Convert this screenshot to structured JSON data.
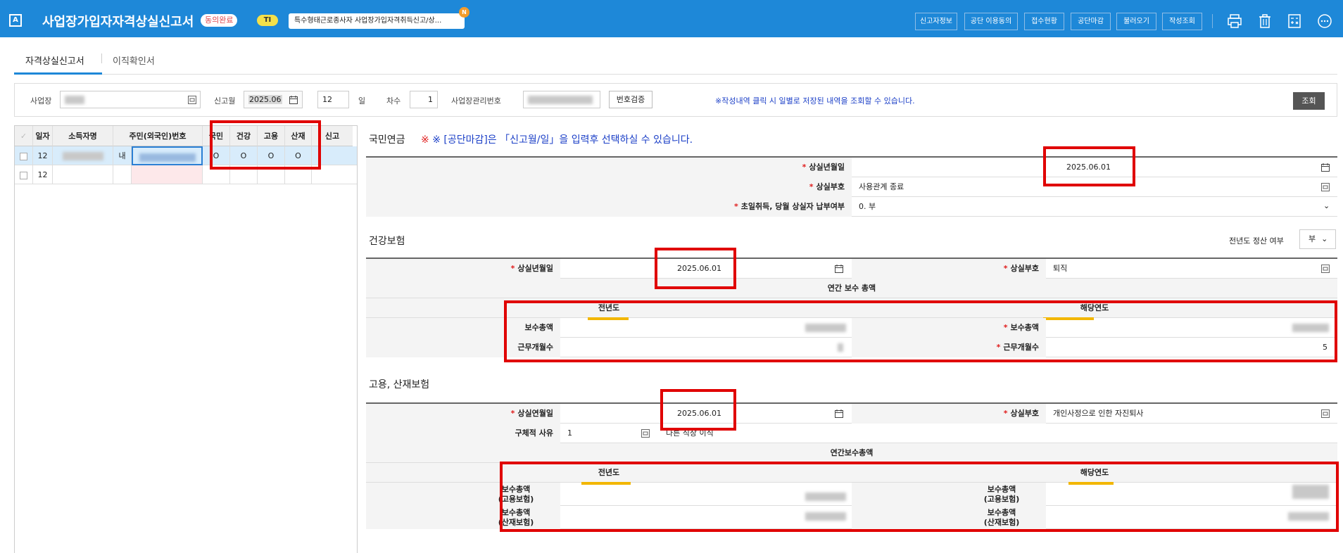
{
  "header": {
    "logo": "A",
    "title": "사업장가입자자격상실신고서",
    "consent_badge": "동의완료",
    "ti_badge": "TI",
    "notice": "특수형태근로종사자 사업장가입자격취득신고/상...",
    "notice_badge": "N",
    "buttons": [
      "신고자정보",
      "공단 이용동의",
      "접수현황",
      "공단마감",
      "불러오기",
      "작성조회"
    ]
  },
  "tabs": [
    "자격상실신고서",
    "이직확인서"
  ],
  "filter": {
    "workplace_label": "사업장",
    "report_month_label": "신고월",
    "report_month": "2025.06",
    "day": "12",
    "day_label": "일",
    "seq_label": "차수",
    "seq": "1",
    "mgmt_no_label": "사업장관리번호",
    "verify_button": "번호검증",
    "notice": "※작성내역 클릭 시 일별로 저장된 내역을 조회할 수 있습니다.",
    "search_button": "조회"
  },
  "grid": {
    "headers": [
      "일자",
      "소득자명",
      "주민(외국인)번호",
      "국민",
      "건강",
      "고용",
      "산재",
      "신고"
    ],
    "rows": [
      {
        "day": "12",
        "nation": "내",
        "national": "O",
        "health": "O",
        "employ": "O",
        "industrial": "O"
      },
      {
        "day": "12",
        "nation": "",
        "national": "",
        "health": "",
        "employ": "",
        "industrial": ""
      }
    ]
  },
  "pension": {
    "title": "국민연금",
    "notice": "※ [공단마감]은 「신고월/일」을 입력후 선택하실 수 있습니다.",
    "loss_date_label": "상실년월일",
    "loss_date": "2025.06.01",
    "loss_code_label": "상실부호",
    "loss_code": "사용관계 종료",
    "first_month_label": "초일취득, 당월 상실자 납부여부",
    "first_month": "0. 부"
  },
  "health": {
    "title": "건강보험",
    "prev_settle_label": "전년도 정산 여부",
    "prev_settle": "부",
    "loss_date_label": "상실년월일",
    "loss_date": "2025.06.01",
    "loss_code_label": "상실부호",
    "loss_code": "퇴직",
    "annual_total_label": "연간 보수 총액",
    "prev_year_label": "전년도",
    "this_year_label": "해당연도",
    "pay_total_label": "보수총액",
    "months_label": "근무개월수",
    "this_year_months": "5"
  },
  "employment": {
    "title": "고용, 산재보험",
    "loss_date_label": "상실연월일",
    "loss_date": "2025.06.01",
    "loss_code_label": "상실부호",
    "loss_code": "개인사정으로 인한 자진퇴사",
    "reason_label": "구체적 사유",
    "reason_code": "1",
    "reason_text": "다른 직장 이직",
    "annual_total_label": "연간보수총액",
    "prev_year_label": "전년도",
    "this_year_label": "해당연도",
    "pay_employ_label_1": "보수총액",
    "pay_employ_label_2": "(고용보험)",
    "pay_ind_label_1": "보수총액",
    "pay_ind_label_2": "(산재보험)"
  }
}
